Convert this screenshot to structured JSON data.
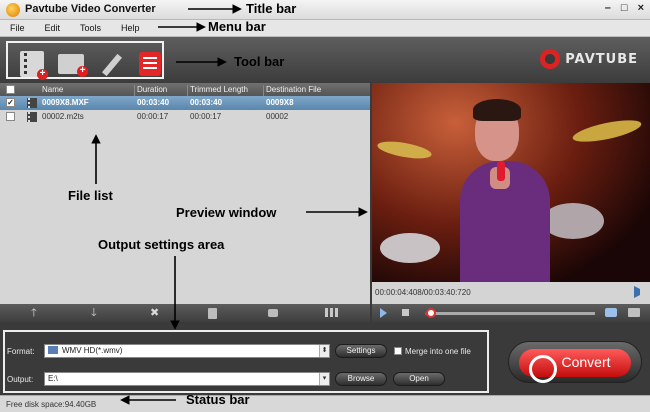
{
  "window": {
    "title": "Pavtube Video Converter",
    "buttons": [
      "–",
      "□",
      "×"
    ]
  },
  "menu": [
    "File",
    "Edit",
    "Tools",
    "Help"
  ],
  "toolbar": {
    "tools": [
      "add-video-icon",
      "add-folder-icon",
      "edit-icon",
      "task-list-icon"
    ],
    "brand": "PAVTUBE"
  },
  "filelist": {
    "columns": [
      "Name",
      "Duration",
      "Trimmed Length",
      "Destination File"
    ],
    "rows": [
      {
        "checked": true,
        "name": "0009X8.MXF",
        "duration": "00:03:40",
        "trimmed": "00:03:40",
        "dest": "0009X8"
      },
      {
        "checked": false,
        "name": "00002.m2ts",
        "duration": "00:00:17",
        "trimmed": "00:00:17",
        "dest": "00002"
      }
    ],
    "actions": [
      "move-up-icon",
      "move-down-icon",
      "remove-icon",
      "delete-icon",
      "subtitle-icon",
      "merge-icon"
    ]
  },
  "preview": {
    "timecode": "00:00:04:408/00:03:40:720",
    "progress": 0.02
  },
  "output": {
    "format_label": "Format:",
    "format_value": "WMV HD(*.wmv)",
    "settings_btn": "Settings",
    "merge_label": "Merge into one file",
    "output_label": "Output:",
    "output_value": "E:\\",
    "browse_btn": "Browse",
    "open_btn": "Open",
    "convert_btn": "Convert"
  },
  "status": {
    "text": "Free disk space:94.40GB"
  },
  "annotations": {
    "title_bar": "Title bar",
    "menu_bar": "Menu bar",
    "tool_bar": "Tool bar",
    "file_list": "File list",
    "preview_window": "Preview window",
    "output_settings": "Output settings area",
    "status_bar": "Status bar"
  }
}
